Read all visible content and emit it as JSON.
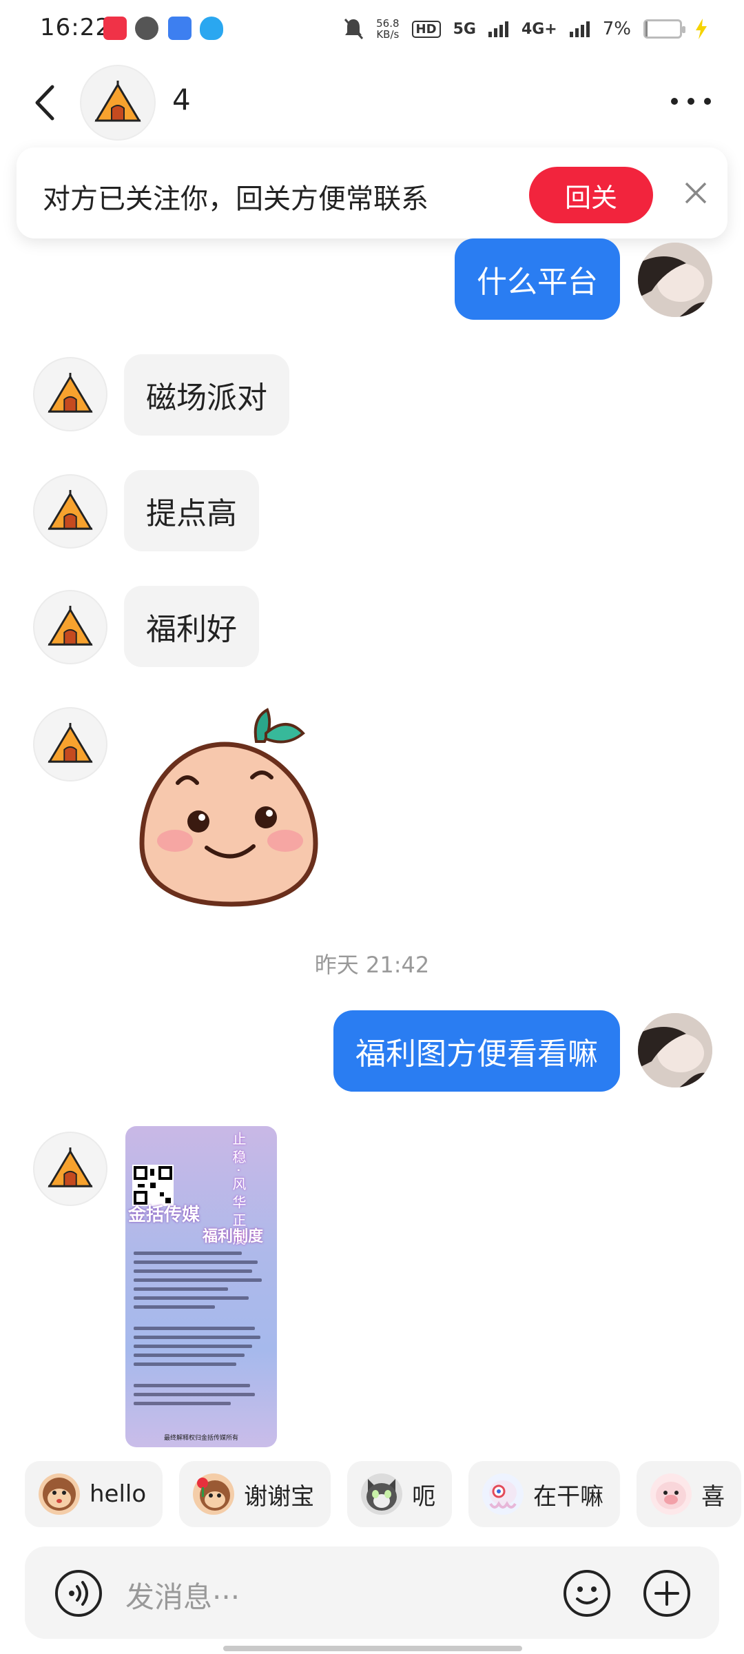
{
  "status_bar": {
    "time": "16:22",
    "net_speed_value": "56.8",
    "net_speed_unit": "KB/s",
    "hd": "HD",
    "sim": "1 2",
    "network_5g": "5G",
    "network_4g": "4G+",
    "battery": "7%"
  },
  "header": {
    "name": "4"
  },
  "follow_banner": {
    "text": "对方已关注你，回关方便常联系",
    "button_label": "回关"
  },
  "messages": {
    "self_1": "什么平台",
    "other_1": "磁场派对",
    "other_2": "提点高",
    "other_3": "福利好",
    "timestamp": "昨天 21:42",
    "self_2": "福利图方便看看嘛"
  },
  "poster": {
    "title": "金括传媒",
    "subtitle": "福利制度",
    "vertical": "止 稳 · 风 华 正 茂",
    "footer": "最终解释权归金括传媒所有"
  },
  "quick_replies": [
    {
      "label": "hello",
      "icon": "monkey-emoji-icon"
    },
    {
      "label": "谢谢宝",
      "icon": "monkey-rose-emoji-icon"
    },
    {
      "label": "呃",
      "icon": "cat-emoji-icon"
    },
    {
      "label": "在干嘛",
      "icon": "octopus-emoji-icon"
    },
    {
      "label": "喜",
      "icon": "pig-emoji-icon"
    }
  ],
  "input": {
    "placeholder": "发消息···"
  },
  "colors": {
    "self_bubble": "#2a7df2",
    "follow_button": "#f2243d",
    "other_bubble": "#f3f3f3"
  }
}
